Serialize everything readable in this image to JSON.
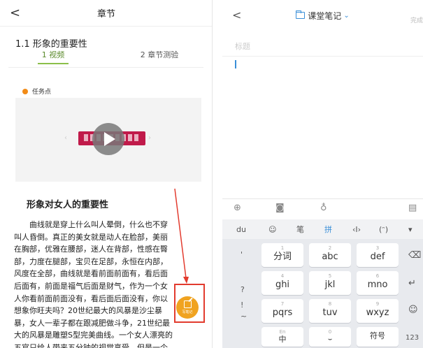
{
  "left": {
    "title": "章节",
    "back": "<",
    "section_title": "1.1 形象的重要性",
    "tabs": [
      {
        "label": "1 视频",
        "active": true
      },
      {
        "label": "2 章节测验",
        "active": false
      }
    ],
    "task_point": "任务点",
    "article_heading": "形象对女人的重要性",
    "paragraph_lines": [
      "曲线就是穿上什么叫人晕倒，什么也不穿",
      "叫人昏倒。真正的美女就是动人在脸部，美丽",
      "在胸部，优雅在腰部，迷人在背部，性感在臀",
      "部，力度在腿部，宝贝在足部，永恒在内部，",
      "风度在全部，曲线就是看前面前面有，看后面",
      "后面有，前面是福气后面是财气，作为一个女",
      "人你看前面前面没有，看后面后面没有，你以",
      "想象你旺夫吗？20世纪最大的风暴是沙尘暴",
      "暴，女人一辈子都在跟减肥做斗争，21世纪最",
      "大的风暴是雕塑S型完美曲线。一个女人漂亮的",
      "五官只给人带来五分钟的视觉享受，但是一个"
    ],
    "fab_label": "写笔记",
    "colors": {
      "accent": "#8bbf4a",
      "fab": "#f0a320",
      "highlight": "#e23b2e"
    }
  },
  "right": {
    "back": "<",
    "notebook": "课堂笔记",
    "done": "完成",
    "title_placeholder": "标题",
    "toolbar_icons": [
      "plus-icon",
      "camera-icon",
      "microphone-icon",
      "keyboard-icon"
    ],
    "keyboard_top": [
      "du",
      "☺",
      "笔",
      "拼",
      "‹I›",
      "(ᵔ)",
      "▾"
    ],
    "left_column": [
      "'",
      "?",
      "!",
      "~"
    ],
    "keys": [
      {
        "num": "1",
        "text": "分词"
      },
      {
        "num": "2",
        "text": "abc"
      },
      {
        "num": "3",
        "text": "def"
      },
      {
        "num": "4",
        "text": "ghi"
      },
      {
        "num": "5",
        "text": "jkl"
      },
      {
        "num": "6",
        "text": "mno"
      },
      {
        "num": "7",
        "text": "pqrs"
      },
      {
        "num": "8",
        "text": "tuv"
      },
      {
        "num": "9",
        "text": "wxyz"
      }
    ],
    "bottom_keys": [
      "中",
      "",
      "符号",
      "123"
    ],
    "bottom_small": [
      "En",
      "0"
    ],
    "right_column": [
      "⌫",
      "↵",
      "☺"
    ]
  }
}
